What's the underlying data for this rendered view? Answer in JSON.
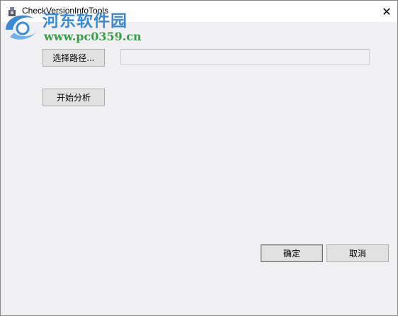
{
  "window": {
    "title": "CheckVersionInfoTools",
    "close_glyph": "✕"
  },
  "watermark": {
    "site_name": "河东软件园",
    "url": "www.pc0359.cn"
  },
  "buttons": {
    "select_path": "选择路径...",
    "start_analysis": "开始分析",
    "ok": "确定",
    "cancel": "取消"
  },
  "path_field": {
    "value": ""
  },
  "colors": {
    "window_bg": "#f0eff2",
    "button_bg": "#e1e1e1",
    "watermark_blue": "#3a8ad6",
    "watermark_green": "#35a146"
  },
  "icons": {
    "app": "app-icon",
    "close": "close-icon"
  }
}
